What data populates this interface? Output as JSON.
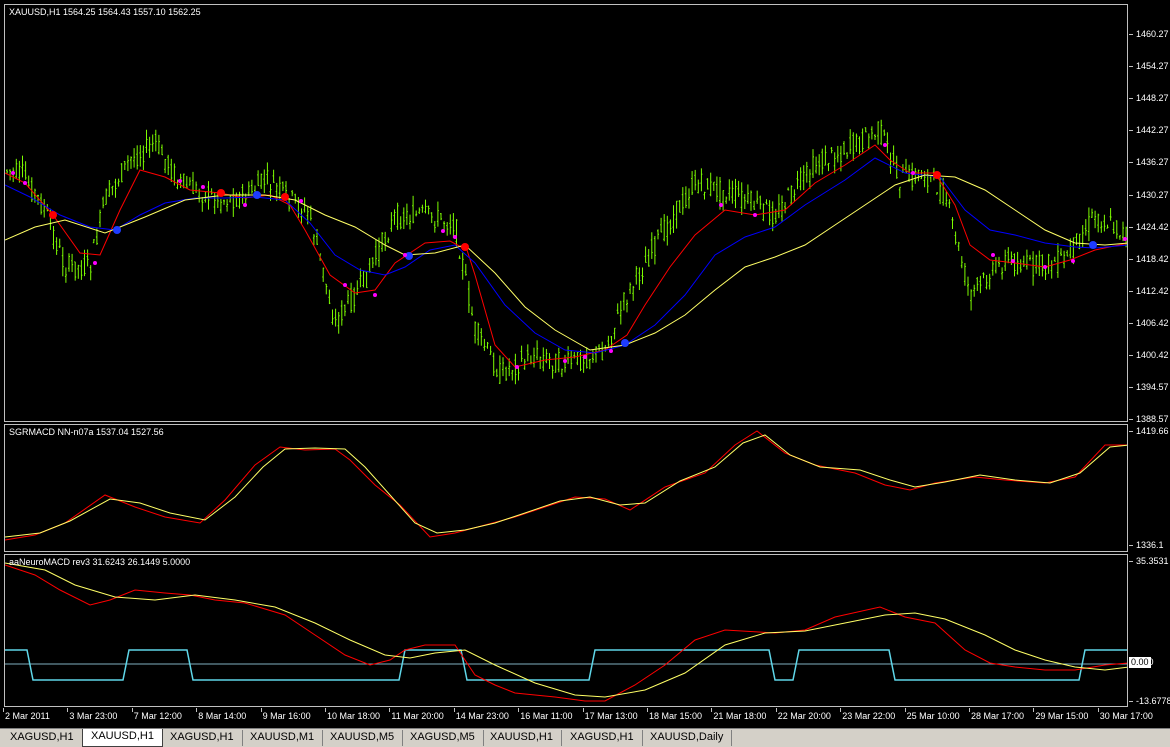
{
  "main_pane": {
    "label": "XAUUSD,H1  1564.25 1564.43 1557.10 1562.25",
    "ticks": [
      "1460.27",
      "1454.27",
      "1448.27",
      "1442.27",
      "1436.27",
      "1430.27",
      "1424.42",
      "1418.42",
      "1412.42",
      "1406.42",
      "1400.42",
      "1394.57",
      "1388.57"
    ],
    "range": [
      1386.5,
      1464.5
    ],
    "colors": {
      "bars": "#7cfc00",
      "red": "#ff0000",
      "blue": "#0000ff",
      "yellow": "#ffff66",
      "dot_red": "#ff0000",
      "dot_blue": "#1e3cff",
      "dot_magenta": "#ff00ff"
    }
  },
  "sgr_pane": {
    "label": "SGRMACD NN-n07a 1537.04 1527.56",
    "ticks": [
      "1419.66",
      "1336.1"
    ],
    "colors": {
      "red": "#ff0000",
      "yellow": "#ffff66"
    }
  },
  "nm_pane": {
    "label": "aaNeuroMACD rev3 31.6243 26.1449 5.0000",
    "ticks": [
      "35.3531",
      "0.00",
      "-13.6778"
    ],
    "current_box": "0.00",
    "colors": {
      "red": "#ff0000",
      "yellow": "#ffff66",
      "cyan": "#5fd6e8",
      "zero": "#7fb0c0"
    }
  },
  "time_axis": [
    "2 Mar 2011",
    "3 Mar 23:00",
    "7 Mar 12:00",
    "8 Mar 14:00",
    "9 Mar 16:00",
    "10 Mar 18:00",
    "11 Mar 20:00",
    "14 Mar 23:00",
    "16 Mar 11:00",
    "17 Mar 13:00",
    "18 Mar 15:00",
    "21 Mar 18:00",
    "22 Mar 20:00",
    "23 Mar 22:00",
    "25 Mar 10:00",
    "28 Mar 17:00",
    "29 Mar 15:00",
    "30 Mar 17:00"
  ],
  "tabs": [
    {
      "label": "XAGUSD,H1",
      "active": false
    },
    {
      "label": "XAUUSD,H1",
      "active": true
    },
    {
      "label": "XAGUSD,H1",
      "active": false
    },
    {
      "label": "XAUUSD,M1",
      "active": false
    },
    {
      "label": "XAUUSD,M5",
      "active": false
    },
    {
      "label": "XAGUSD,M5",
      "active": false
    },
    {
      "label": "XAUUSD,H1",
      "active": false
    },
    {
      "label": "XAGUSD,H1",
      "active": false
    },
    {
      "label": "XAUUSD,Daily",
      "active": false
    }
  ]
}
